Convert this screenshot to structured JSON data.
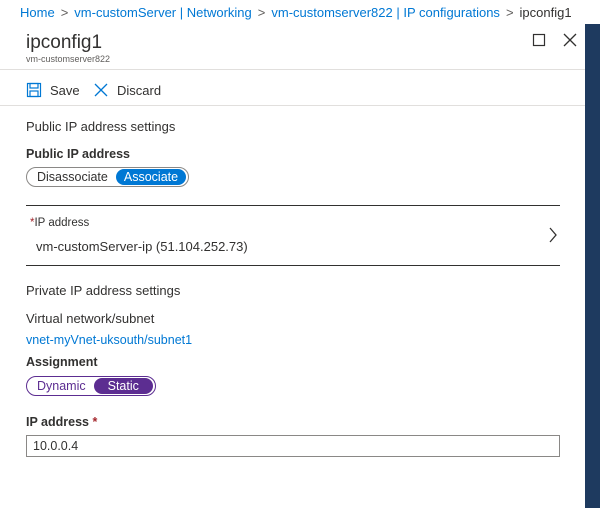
{
  "breadcrumb": {
    "items": [
      "Home",
      "vm-customServer | Networking",
      "vm-customserver822 | IP configurations"
    ],
    "current": "ipconfig1",
    "separator": ">"
  },
  "header": {
    "title": "ipconfig1",
    "subtitle": "vm-customserver822"
  },
  "toolbar": {
    "save_label": "Save",
    "discard_label": "Discard"
  },
  "public_ip": {
    "section_title": "Public IP address settings",
    "field_label": "Public IP address",
    "options": [
      "Disassociate",
      "Associate"
    ],
    "selected": "Associate",
    "ip_field": {
      "required_mark": "*",
      "label": "IP address",
      "value": "vm-customServer-ip (51.104.252.73)"
    }
  },
  "private_ip": {
    "section_title": "Private IP address settings",
    "vnet_label": "Virtual network/subnet",
    "vnet_link": "vnet-myVnet-uksouth/subnet1",
    "assignment_label": "Assignment",
    "assignment_options": [
      "Dynamic",
      "Static"
    ],
    "assignment_selected": "Static",
    "ip_label": "IP address",
    "ip_required_mark": "*",
    "ip_value": "10.0.0.4"
  },
  "colors": {
    "link": "#0078d4",
    "associate_selected": "#0078d4",
    "static_selected": "#5c2d91",
    "side_bar": "#1e3a5f",
    "required": "#a4262c"
  }
}
